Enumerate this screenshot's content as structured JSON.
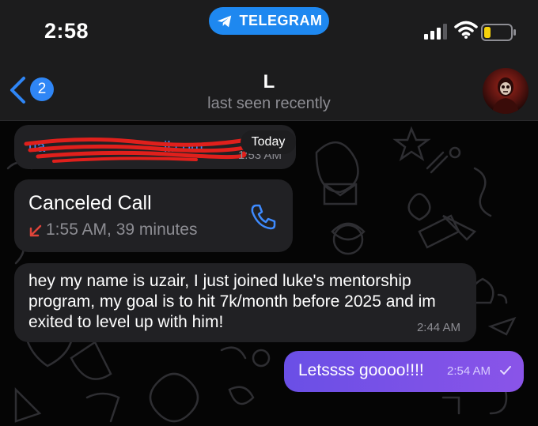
{
  "status_bar": {
    "time": "2:58",
    "app_pill": "TELEGRAM",
    "battery_level": 0.25
  },
  "header": {
    "back_badge": "2",
    "title": "L",
    "subtitle": "last seen recently"
  },
  "messages": {
    "email": {
      "partial_text": "ua",
      "partial_text_2": "il.com",
      "time": "1:53 AM",
      "date_label": "Today"
    },
    "call": {
      "title": "Canceled Call",
      "meta": "1:55 AM, 39 minutes"
    },
    "incoming": {
      "text": "hey my name is uzair, I just joined luke's mentorship program, my goal is to hit 7k/month before 2025 and im exited to level up with him!",
      "time": "2:44 AM"
    },
    "outgoing": {
      "text": "Letssss goooo!!!!",
      "time": "2:54 AM"
    }
  },
  "colors": {
    "accent": "#3e8bff",
    "outgoing_start": "#6a4fe6",
    "outgoing_end": "#8a54e8",
    "bubble": "#212124",
    "redaction": "#e0201c",
    "missed_call": "#e0443a"
  }
}
